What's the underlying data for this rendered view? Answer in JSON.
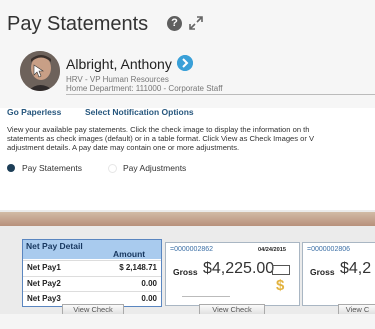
{
  "page": {
    "title": "Pay Statements",
    "help_symbol": "?"
  },
  "employee": {
    "name": "Albright, Anthony",
    "position": "HRV - VP Human Resources",
    "department": "Home Department: 111000 - Corporate Staff"
  },
  "links": {
    "go_paperless": "Go Paperless",
    "select_notification": "Select Notification Options"
  },
  "description": [
    "View your available pay statements. Click the check image to display the information on th",
    "statements as check images (default) or in a table format. Click View as Check Images or V",
    "adjustment details. A pay date may contain one or more adjustments."
  ],
  "view_options": {
    "selected": "Pay Statements",
    "options": [
      "Pay Statements",
      "Pay Adjustments"
    ]
  },
  "net_pay_detail": {
    "header_label": "Net Pay Detail",
    "header_amount": "Amount",
    "rows": [
      {
        "label": "Net Pay1",
        "amount": "$ 2,148.71"
      },
      {
        "label": "Net Pay2",
        "amount": "0.00"
      },
      {
        "label": "Net Pay3",
        "amount": "0.00"
      }
    ]
  },
  "checks": [
    {
      "number": "=0000002862",
      "date": "04/24/2015",
      "gross_label": "Gross",
      "amount": "$4,225.00",
      "view_label": "View Check"
    },
    {
      "number": "=0000002806",
      "date": "",
      "gross_label": "Gross",
      "amount": "$4,2",
      "view_label": "View C"
    }
  ],
  "detail_view_label": "View Check",
  "colors": {
    "link": "#27577e",
    "detail_header": "#a9cbee",
    "check_number": "#3a6ea5",
    "radio_selected": "#1d3e57",
    "go_button": "#3aa0d8"
  },
  "icons": {
    "help": "help-circle-icon",
    "expand": "expand-arrows-icon",
    "go": "chevron-right-circle-icon",
    "dollar": "dollar-sign-icon"
  }
}
